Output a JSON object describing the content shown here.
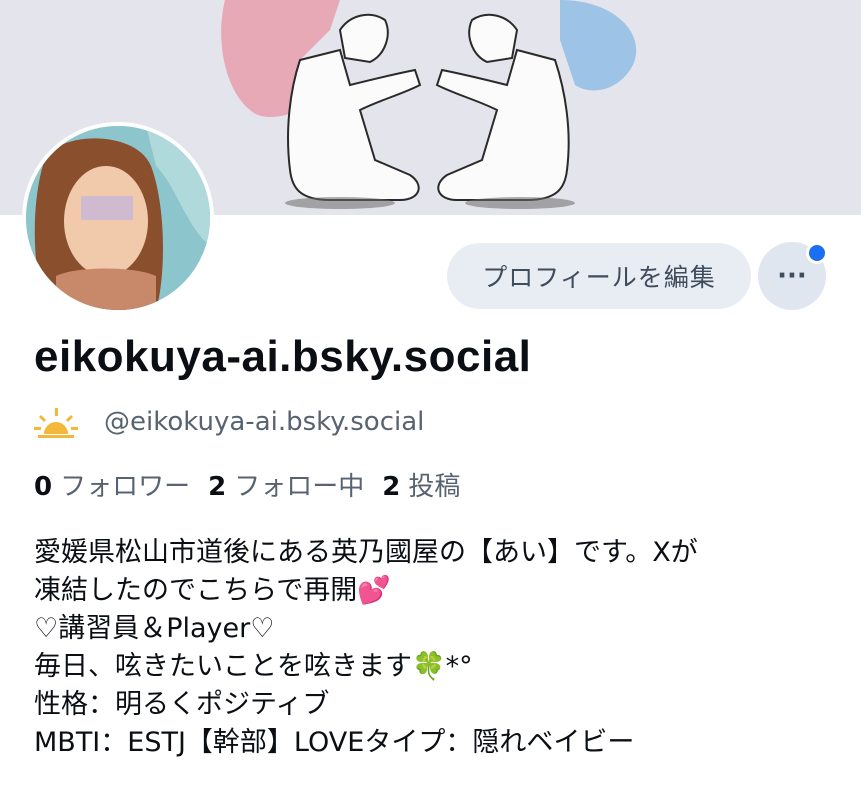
{
  "profile": {
    "display_name": "eikokuya-ai.bsky.social",
    "handle": "@eikokuya-ai.bsky.social",
    "badge_icon": "sun-icon",
    "edit_button_label": "プロフィールを編集",
    "more_button_label": "···",
    "has_notification_dot": true
  },
  "stats": {
    "followers_count": "0",
    "followers_label": "フォロワー",
    "following_count": "2",
    "following_label": "フォロー中",
    "posts_count": "2",
    "posts_label": "投稿"
  },
  "bio": {
    "lines": [
      "愛媛県松山市道後にある英乃國屋の【あい】です。Xが",
      "凍結したのでこちらで再開💕",
      "♡講習員＆Player♡",
      "毎日、呟きたいことを呟きます🍀*°",
      "性格：明るくポジティブ",
      "MBTI：ESTJ【幹部】LOVEタイプ：隠れベイビー"
    ]
  },
  "colors": {
    "banner_bg": "#e4e4ec",
    "pink_hair": "#e8a9b7",
    "blue_hair": "#9dc3e6",
    "button_bg": "#e8edf4",
    "accent_blue": "#1d6ff2",
    "muted_text": "#586270"
  }
}
